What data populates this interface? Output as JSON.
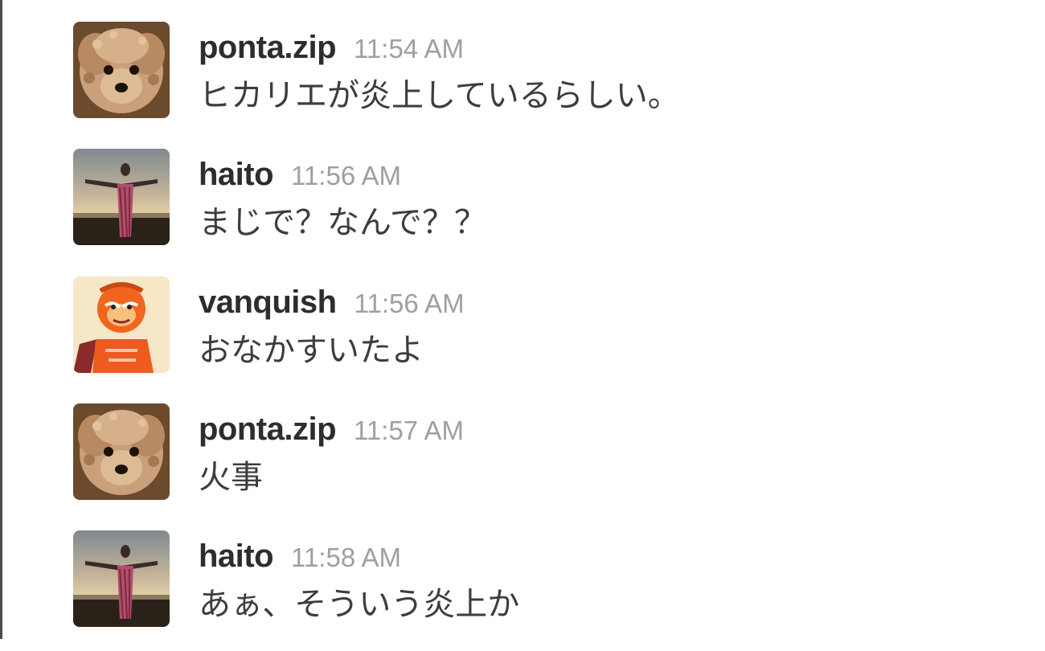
{
  "messages": [
    {
      "user": "ponta.zip",
      "time": "11:54 AM",
      "text": "ヒカリエが炎上しているらしい。",
      "avatar": "dog-avatar"
    },
    {
      "user": "haito",
      "time": "11:56 AM",
      "text": "まじで？なんで？？",
      "avatar": "person-outstretched-avatar"
    },
    {
      "user": "vanquish",
      "time": "11:56 AM",
      "text": "おなかすいたよ",
      "avatar": "cartoon-hero-avatar"
    },
    {
      "user": "ponta.zip",
      "time": "11:57 AM",
      "text": "火事",
      "avatar": "dog-avatar"
    },
    {
      "user": "haito",
      "time": "11:58 AM",
      "text": "あぁ、そういう炎上か",
      "avatar": "person-outstretched-avatar"
    }
  ],
  "colors": {
    "username": "#2c2d30",
    "timestamp": "#9e9ea6",
    "message_text": "#3d3c40",
    "left_rule": "#4b4b4b"
  }
}
